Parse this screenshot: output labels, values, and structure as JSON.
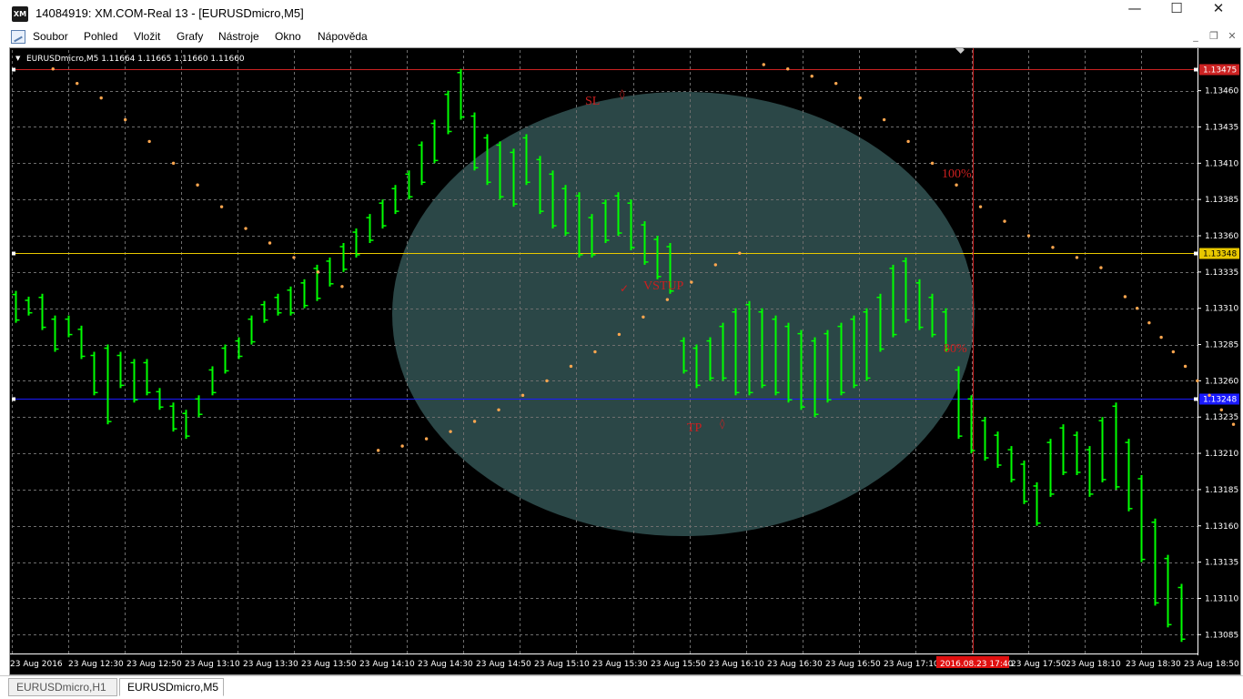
{
  "window": {
    "logo": "XM",
    "title": "14084919: XM.COM-Real 13 - [EURUSDmicro,M5]",
    "minimize": "—",
    "maximize": "☐",
    "close": "✕"
  },
  "menu": {
    "items": [
      "Soubor",
      "Pohled",
      "Vložit",
      "Grafy",
      "Nástroje",
      "Okno",
      "Nápověda"
    ],
    "mdi_minimize": "_",
    "mdi_restore": "❐",
    "mdi_close": "✕"
  },
  "tabs": [
    {
      "label": "EURUSDmicro,H1",
      "active": false
    },
    {
      "label": "EURUSDmicro,M5",
      "active": true
    }
  ],
  "colors": {
    "background": "#000000",
    "grid": "#6e6e6e",
    "bars": "#00ff00",
    "sar": "#ffa74f",
    "sl_line": "#cc2222",
    "entry_line": "#e8c800",
    "tp_line": "#1a1aff",
    "circle": "#2f4d4d",
    "annotation": "#cc1f1f"
  },
  "chart_data": {
    "type": "ohlc",
    "symbol": "EURUSDmicro",
    "timeframe": "M5",
    "header": "EURUSDmicro,M5  1.11664 1.11665 1.11660 1.11660",
    "ylim": [
      1.13072,
      1.13483
    ],
    "y_ticks": [
      "1.13085",
      "1.13110",
      "1.13135",
      "1.13160",
      "1.13185",
      "1.13210",
      "1.13235",
      "1.13260",
      "1.13285",
      "1.13310",
      "1.13335",
      "1.13360",
      "1.13385",
      "1.13410",
      "1.13435",
      "1.13460"
    ],
    "x_labels": [
      "23 Aug 2016",
      "23 Aug 12:30",
      "23 Aug 12:50",
      "23 Aug 13:10",
      "23 Aug 13:30",
      "23 Aug 13:50",
      "23 Aug 14:10",
      "23 Aug 14:30",
      "23 Aug 14:50",
      "23 Aug 15:10",
      "23 Aug 15:30",
      "23 Aug 15:50",
      "23 Aug 16:10",
      "23 Aug 16:30",
      "23 Aug 16:50",
      "23 Aug 17:10",
      "2016.08.23 17:40",
      "23 Aug 17:50",
      "23 Aug 18:10",
      "23 Aug 18:30",
      "23 Aug 18:50"
    ],
    "levels": [
      {
        "name": "SL",
        "price": 1.13475,
        "label": "1.13475"
      },
      {
        "name": "VSTUP",
        "price": 1.13348,
        "label": "1.13348"
      },
      {
        "name": "TP",
        "price": 1.13248,
        "label": "1.13248"
      }
    ],
    "crosshair_time": "2016.08.23 17:40",
    "annotations": [
      "SL",
      "VSTUP",
      "TP",
      "100%",
      "80%"
    ],
    "bars": [
      [
        1.13322,
        1.133
      ],
      [
        1.13318,
        1.13305
      ],
      [
        1.1332,
        1.13295
      ],
      [
        1.13305,
        1.1328
      ],
      [
        1.13305,
        1.1329
      ],
      [
        1.13298,
        1.13275
      ],
      [
        1.1328,
        1.1325
      ],
      [
        1.13285,
        1.1323
      ],
      [
        1.1328,
        1.13255
      ],
      [
        1.13275,
        1.13245
      ],
      [
        1.13275,
        1.1325
      ],
      [
        1.13255,
        1.1324
      ],
      [
        1.13245,
        1.13225
      ],
      [
        1.1324,
        1.1322
      ],
      [
        1.1325,
        1.13235
      ],
      [
        1.1327,
        1.1325
      ],
      [
        1.13285,
        1.13265
      ],
      [
        1.1329,
        1.13275
      ],
      [
        1.13305,
        1.13285
      ],
      [
        1.13315,
        1.133
      ],
      [
        1.1332,
        1.13305
      ],
      [
        1.13325,
        1.13305
      ],
      [
        1.1333,
        1.1331
      ],
      [
        1.1334,
        1.13315
      ],
      [
        1.13345,
        1.13325
      ],
      [
        1.13355,
        1.13335
      ],
      [
        1.13365,
        1.13345
      ],
      [
        1.13375,
        1.13355
      ],
      [
        1.13385,
        1.13365
      ],
      [
        1.13395,
        1.13375
      ],
      [
        1.13405,
        1.13385
      ],
      [
        1.13425,
        1.13395
      ],
      [
        1.1344,
        1.1341
      ],
      [
        1.1346,
        1.1343
      ],
      [
        1.13475,
        1.1344
      ],
      [
        1.13445,
        1.13405
      ],
      [
        1.1343,
        1.13395
      ],
      [
        1.13425,
        1.13385
      ],
      [
        1.1342,
        1.1338
      ],
      [
        1.1343,
        1.13395
      ],
      [
        1.13415,
        1.13375
      ],
      [
        1.13405,
        1.13365
      ],
      [
        1.13395,
        1.1336
      ],
      [
        1.1339,
        1.13345
      ],
      [
        1.13375,
        1.13345
      ],
      [
        1.13385,
        1.13355
      ],
      [
        1.1339,
        1.1336
      ],
      [
        1.13385,
        1.1335
      ],
      [
        1.1337,
        1.1334
      ],
      [
        1.1336,
        1.1333
      ],
      [
        1.13355,
        1.1332
      ],
      [
        1.1329,
        1.13265
      ],
      [
        1.13285,
        1.13255
      ],
      [
        1.1329,
        1.1326
      ],
      [
        1.133,
        1.1326
      ],
      [
        1.1331,
        1.1325
      ],
      [
        1.13315,
        1.1325
      ],
      [
        1.1331,
        1.13255
      ],
      [
        1.13305,
        1.1325
      ],
      [
        1.133,
        1.13245
      ],
      [
        1.13295,
        1.1324
      ],
      [
        1.1329,
        1.13235
      ],
      [
        1.13295,
        1.13245
      ],
      [
        1.133,
        1.1325
      ],
      [
        1.13305,
        1.13255
      ],
      [
        1.1331,
        1.1326
      ],
      [
        1.1332,
        1.1328
      ],
      [
        1.1334,
        1.1329
      ],
      [
        1.13345,
        1.133
      ],
      [
        1.1333,
        1.13295
      ],
      [
        1.1332,
        1.1329
      ],
      [
        1.1331,
        1.1328
      ],
      [
        1.1327,
        1.1322
      ],
      [
        1.1325,
        1.1321
      ],
      [
        1.13235,
        1.13205
      ],
      [
        1.13225,
        1.132
      ],
      [
        1.13215,
        1.1319
      ],
      [
        1.13205,
        1.13175
      ],
      [
        1.1319,
        1.1316
      ],
      [
        1.1322,
        1.1318
      ],
      [
        1.1323,
        1.13195
      ],
      [
        1.13225,
        1.13195
      ],
      [
        1.13215,
        1.1318
      ],
      [
        1.13235,
        1.1319
      ],
      [
        1.13245,
        1.13185
      ],
      [
        1.1322,
        1.1317
      ],
      [
        1.13195,
        1.13135
      ],
      [
        1.13165,
        1.13105
      ],
      [
        1.1314,
        1.1309
      ],
      [
        1.1312,
        1.1308
      ]
    ],
    "sar_points": [
      [
        1.13475,
        1
      ],
      [
        1.13465,
        3
      ],
      [
        1.13455,
        5
      ],
      [
        1.1344,
        7
      ],
      [
        1.13425,
        9
      ],
      [
        1.1341,
        11
      ],
      [
        1.13395,
        13
      ],
      [
        1.1338,
        15
      ],
      [
        1.13365,
        17
      ],
      [
        1.13355,
        19
      ],
      [
        1.13345,
        21
      ],
      [
        1.13335,
        23
      ],
      [
        1.13325,
        25
      ],
      [
        1.13212,
        28
      ],
      [
        1.13215,
        30
      ],
      [
        1.1322,
        32
      ],
      [
        1.13225,
        34
      ],
      [
        1.13232,
        36
      ],
      [
        1.1324,
        38
      ],
      [
        1.1325,
        40
      ],
      [
        1.1326,
        42
      ],
      [
        1.1327,
        44
      ],
      [
        1.1328,
        46
      ],
      [
        1.13292,
        48
      ],
      [
        1.13304,
        50
      ],
      [
        1.13316,
        52
      ],
      [
        1.13328,
        54
      ],
      [
        1.1334,
        56
      ],
      [
        1.13348,
        58
      ],
      [
        1.13478,
        60
      ],
      [
        1.13475,
        62
      ],
      [
        1.1347,
        64
      ],
      [
        1.13465,
        66
      ],
      [
        1.13455,
        68
      ],
      [
        1.1344,
        70
      ],
      [
        1.13425,
        72
      ],
      [
        1.1341,
        74
      ],
      [
        1.13395,
        76
      ],
      [
        1.1338,
        78
      ],
      [
        1.1337,
        80
      ],
      [
        1.1336,
        82
      ],
      [
        1.13352,
        84
      ],
      [
        1.13345,
        86
      ],
      [
        1.13338,
        88
      ],
      [
        1.13318,
        90
      ],
      [
        1.1331,
        91
      ],
      [
        1.133,
        92
      ],
      [
        1.1329,
        93
      ],
      [
        1.1328,
        94
      ],
      [
        1.1327,
        95
      ],
      [
        1.1326,
        96
      ],
      [
        1.1325,
        97
      ],
      [
        1.1324,
        98
      ],
      [
        1.1323,
        99
      ]
    ]
  }
}
